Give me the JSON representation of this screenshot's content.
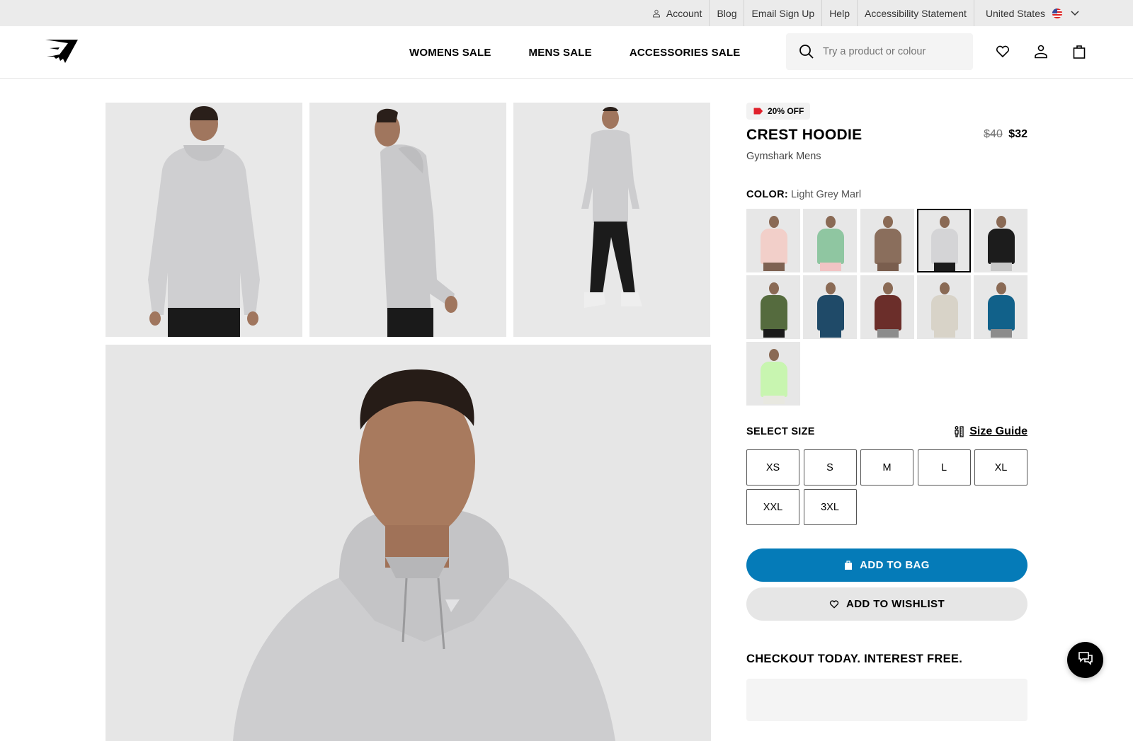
{
  "utility_bar": {
    "items": [
      {
        "label": "Account",
        "icon": "person-icon"
      },
      {
        "label": "Blog"
      },
      {
        "label": "Email Sign Up"
      },
      {
        "label": "Help"
      },
      {
        "label": "Accessibility Statement"
      }
    ],
    "country": {
      "label": "United States",
      "icon": "us-flag-icon"
    }
  },
  "header": {
    "logo": "gymshark-logo",
    "nav": [
      {
        "label": "WOMENS SALE"
      },
      {
        "label": "MENS SALE"
      },
      {
        "label": "ACCESSORIES SALE"
      }
    ],
    "search": {
      "placeholder": "Try a product or colour",
      "value": ""
    },
    "icons": [
      "heart-icon",
      "account-icon",
      "bag-icon"
    ]
  },
  "product": {
    "badge": "20% OFF",
    "badge_color": "#e0202b",
    "name": "CREST HOODIE",
    "old_price": "$40",
    "price": "$32",
    "subtitle": "Gymshark Mens",
    "color_label": "COLOR:",
    "color_value": "Light Grey Marl",
    "swatches": [
      {
        "name": "Pink",
        "hex": "#f2cfc9",
        "pants": "#7e6252",
        "selected": false
      },
      {
        "name": "Green",
        "hex": "#8fc6a1",
        "pants": "#f1c4c4",
        "selected": false
      },
      {
        "name": "Brown",
        "hex": "#8a6e5c",
        "pants": "#7a5e4e",
        "selected": false
      },
      {
        "name": "Light Grey Marl",
        "hex": "#d4d4d6",
        "pants": "#1b1b1b",
        "selected": true
      },
      {
        "name": "Black",
        "hex": "#1c1c1c",
        "pants": "#c8c8c8",
        "selected": false
      },
      {
        "name": "Olive",
        "hex": "#556b3e",
        "pants": "#1a1a1a",
        "selected": false
      },
      {
        "name": "Navy",
        "hex": "#1f4a68",
        "pants": "#1f4a68",
        "selected": false
      },
      {
        "name": "Maroon",
        "hex": "#6b2e2a",
        "pants": "#8c8c8c",
        "selected": false
      },
      {
        "name": "Stone",
        "hex": "#d8d3c8",
        "pants": "#d8d3c8",
        "selected": false
      },
      {
        "name": "Teal Blue",
        "hex": "#11618a",
        "pants": "#8c8c8c",
        "selected": false
      },
      {
        "name": "Lime",
        "hex": "#c8f5b0",
        "pants": "#e8e8e0",
        "selected": false
      }
    ],
    "size_title": "SELECT SIZE",
    "size_guide": "Size Guide",
    "sizes": [
      "XS",
      "S",
      "M",
      "L",
      "XL",
      "XXL",
      "3XL"
    ],
    "add_to_bag": "ADD TO BAG",
    "add_to_wishlist": "ADD TO WISHLIST",
    "checkout_title": "CHECKOUT TODAY. INTEREST FREE.",
    "accent_color": "#057bb8"
  },
  "gallery": {
    "images": [
      "back-view",
      "side-view",
      "full-body-view",
      "close-up-view"
    ]
  },
  "chat": {
    "icon": "chat-icon"
  }
}
